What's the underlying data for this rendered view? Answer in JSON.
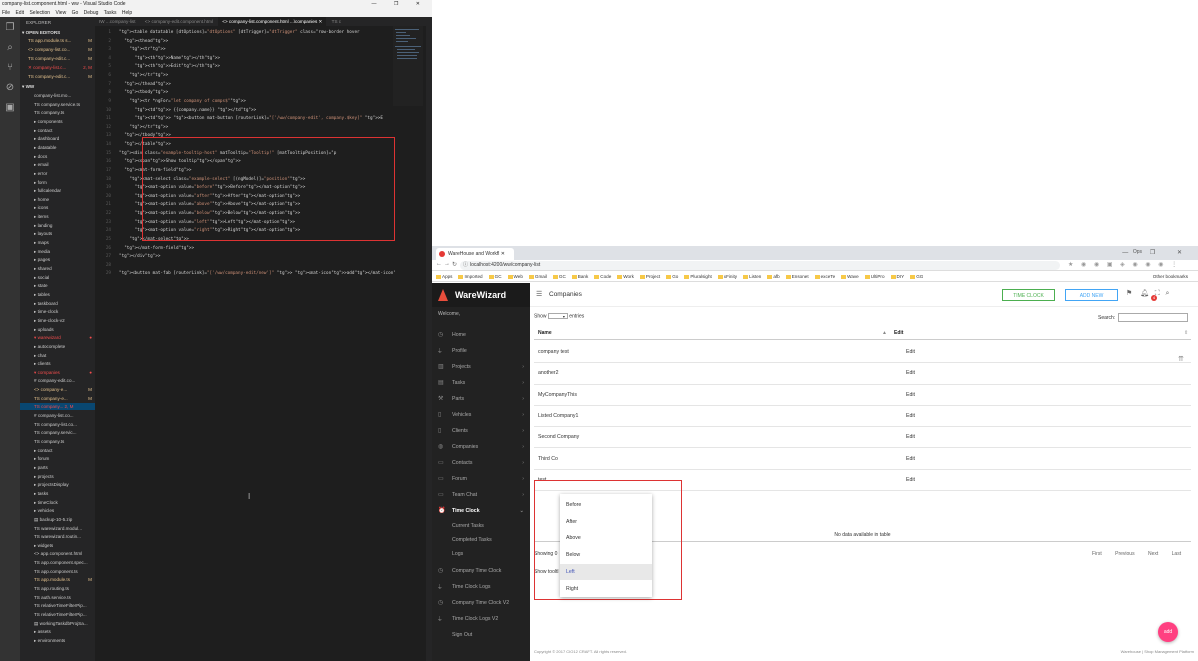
{
  "vscode": {
    "title": "company-list.component.html - ww - Visual Studio Code",
    "window_controls": "—  ❐  ✕",
    "menu": [
      "File",
      "Edit",
      "Selection",
      "View",
      "Go",
      "Debug",
      "Tasks",
      "Help"
    ],
    "explorer_label": "EXPLORER",
    "open_editors_label": "▾ OPEN EDITORS",
    "open_editors": [
      {
        "name": "TS app.module.ts  s...",
        "badge": "M",
        "cls": "m"
      },
      {
        "name": "<> company-list.co...",
        "badge": "M",
        "cls": "m"
      },
      {
        "name": "TS company-edit.c...",
        "badge": "M",
        "cls": "m"
      },
      {
        "name": "✕ company-list.c...",
        "badge": "2, M",
        "cls": "r"
      },
      {
        "name": "TS company-edit.c...",
        "badge": "M",
        "cls": "m"
      }
    ],
    "root_label": "▾ WW",
    "tree": [
      {
        "name": "company-list.mo...",
        "cls": ""
      },
      {
        "name": "TS company.service.ts",
        "cls": ""
      },
      {
        "name": "TS company.ts",
        "cls": ""
      },
      {
        "name": "▸ components",
        "cls": ""
      },
      {
        "name": "▸ contact",
        "cls": ""
      },
      {
        "name": "▸ dashboard",
        "cls": ""
      },
      {
        "name": "▸ datatable",
        "cls": ""
      },
      {
        "name": "▸ docs",
        "cls": ""
      },
      {
        "name": "▸ email",
        "cls": ""
      },
      {
        "name": "▸ error",
        "cls": ""
      },
      {
        "name": "▸ form",
        "cls": ""
      },
      {
        "name": "▸ fullcalendar",
        "cls": ""
      },
      {
        "name": "▸ home",
        "cls": ""
      },
      {
        "name": "▸ icons",
        "cls": ""
      },
      {
        "name": "▸ items",
        "cls": ""
      },
      {
        "name": "▸ landing",
        "cls": ""
      },
      {
        "name": "▸ layouts",
        "cls": ""
      },
      {
        "name": "▸ maps",
        "cls": ""
      },
      {
        "name": "▸ media",
        "cls": ""
      },
      {
        "name": "▸ pages",
        "cls": ""
      },
      {
        "name": "▸ shared",
        "cls": ""
      },
      {
        "name": "▸ social",
        "cls": ""
      },
      {
        "name": "▸ state",
        "cls": ""
      },
      {
        "name": "▸ tables",
        "cls": ""
      },
      {
        "name": "▸ taskboard",
        "cls": ""
      },
      {
        "name": "▸ time-clock",
        "cls": ""
      },
      {
        "name": "▸ time-clock-v2",
        "cls": ""
      },
      {
        "name": "▸ uploads",
        "cls": ""
      },
      {
        "name": "▾ warewizard",
        "cls": "r",
        "badge": "●"
      },
      {
        "name": "  ▸ autocomplete",
        "cls": ""
      },
      {
        "name": "  ▸ chat",
        "cls": ""
      },
      {
        "name": "  ▸ clients",
        "cls": ""
      },
      {
        "name": "  ▾ companies",
        "cls": "r",
        "badge": "●"
      },
      {
        "name": "    # company-edit.co...",
        "cls": ""
      },
      {
        "name": "    <> company-e...",
        "cls": "m",
        "badge": "M"
      },
      {
        "name": "    TS company-e...",
        "cls": "m",
        "badge": "M"
      },
      {
        "name": "    TS company... 2, M",
        "cls": "r",
        "sel": true
      },
      {
        "name": "    # company-list.co...",
        "cls": ""
      },
      {
        "name": "    TS company-list.co...",
        "cls": ""
      },
      {
        "name": "    TS company.servic...",
        "cls": ""
      },
      {
        "name": "    TS company.ts",
        "cls": ""
      },
      {
        "name": "  ▸ contact",
        "cls": ""
      },
      {
        "name": "  ▸ forum",
        "cls": ""
      },
      {
        "name": "  ▸ parts",
        "cls": ""
      },
      {
        "name": "  ▸ projects",
        "cls": ""
      },
      {
        "name": "  ▸ projectsDisplay",
        "cls": ""
      },
      {
        "name": "  ▸ tasks",
        "cls": ""
      },
      {
        "name": "  ▸ timeClock",
        "cls": ""
      },
      {
        "name": "  ▸ vehicles",
        "cls": ""
      },
      {
        "name": "  ▤ backup-10-5.zip",
        "cls": ""
      },
      {
        "name": "  TS warewizard.modul...",
        "cls": ""
      },
      {
        "name": "  TS warewizard.routin...",
        "cls": ""
      },
      {
        "name": "▸ widgets",
        "cls": ""
      },
      {
        "name": "<> app.component.html",
        "cls": ""
      },
      {
        "name": "TS app.component.spec...",
        "cls": ""
      },
      {
        "name": "TS app.component.ts",
        "cls": ""
      },
      {
        "name": "TS app.module.ts",
        "cls": "m",
        "badge": "M"
      },
      {
        "name": "TS app.routing.ts",
        "cls": ""
      },
      {
        "name": "TS auth.service.ts",
        "cls": ""
      },
      {
        "name": "TS relativeTimeFilterPip...",
        "cls": ""
      },
      {
        "name": "TS relativeTimeFilterPip...",
        "cls": ""
      },
      {
        "name": "▤ workingTaskdbProjSa...",
        "cls": ""
      },
      {
        "name": "▸ assets",
        "cls": ""
      },
      {
        "name": "▸ environments",
        "cls": ""
      }
    ],
    "tabs": [
      {
        "label": "IW  ...company-list",
        "active": false
      },
      {
        "label": "<> company-edit.component.html",
        "active": false
      },
      {
        "label": "<> company-list.component.html  ...\\companies ✕",
        "active": true
      },
      {
        "label": "TS c",
        "active": false
      }
    ],
    "code": [
      {
        "n": "1",
        "t": "<table datatable [dtOptions]=\"dtOptions\" [dtTrigger]=\"dtTrigger\" class=\"row-border hover"
      },
      {
        "n": "2",
        "t": "  <thead>"
      },
      {
        "n": "3",
        "t": "    <tr>"
      },
      {
        "n": "4",
        "t": "      <th>Name</th>"
      },
      {
        "n": "5",
        "t": "      <th>Edit</th>"
      },
      {
        "n": "6",
        "t": "    </tr>"
      },
      {
        "n": "7",
        "t": "  </thead>"
      },
      {
        "n": "8",
        "t": "  <tbody>"
      },
      {
        "n": "9",
        "t": "    <tr *ngFor=\"let company of comps$\">"
      },
      {
        "n": "10",
        "t": "      <td> {{company.name}} </td>"
      },
      {
        "n": "11",
        "t": "      <td> <button mat-button [routerLink]=\"['/ww/company-edit', company.$key]\" >E"
      },
      {
        "n": "12",
        "t": "    </tr>"
      },
      {
        "n": "13",
        "t": "  </tbody>"
      },
      {
        "n": "14",
        "t": "  </table>"
      },
      {
        "n": "15",
        "t": "<div class=\"example-tooltip-host\" matTooltip=\"Tooltip!\" [matTooltipPosition]=\"p"
      },
      {
        "n": "16",
        "t": "  <span>Show tooltip</span>"
      },
      {
        "n": "17",
        "t": "  <mat-form-field>"
      },
      {
        "n": "18",
        "t": "    <mat-select class=\"example-select\" [(ngModel)]=\"position\">"
      },
      {
        "n": "19",
        "t": "      <mat-option value=\"before\">Before</mat-option>"
      },
      {
        "n": "20",
        "t": "      <mat-option value=\"after\">After</mat-option>"
      },
      {
        "n": "21",
        "t": "      <mat-option value=\"above\">Above</mat-option>"
      },
      {
        "n": "22",
        "t": "      <mat-option value=\"below\">Below</mat-option>"
      },
      {
        "n": "23",
        "t": "      <mat-option value=\"left\">Left</mat-option>"
      },
      {
        "n": "24",
        "t": "      <mat-option value=\"right\">Right</mat-option>"
      },
      {
        "n": "25",
        "t": "    </mat-select>"
      },
      {
        "n": "26",
        "t": "  </mat-form-field>"
      },
      {
        "n": "27",
        "t": "</div>"
      },
      {
        "n": "28",
        "t": ""
      },
      {
        "n": "29",
        "t": "<button mat-fab [routerLink]=\"['/ww/company-edit/new']\" > <mat-icon>add</mat-icon> </but"
      }
    ]
  },
  "browser": {
    "tab_title": "WareHouse and Workfl ✕",
    "profile": "Ops",
    "window_controls": "—  ❐  ✕",
    "url": "localhost:4200/ww/company-list",
    "bookmarks": [
      "Apps",
      "Imported",
      "GC",
      "Web",
      "Gmail",
      "GC",
      "Bank",
      "Code",
      "Work",
      "Project",
      "Go",
      "Pluralsight",
      "xFinity",
      "Listen",
      "afb",
      "Ensonet",
      "exceTe",
      "Wave",
      "UltiPro",
      "DIY",
      "GG"
    ],
    "other_bookmarks": "Other bookmarks"
  },
  "app": {
    "brand": "WareWizard",
    "welcome": "Welcome,",
    "nav": [
      {
        "icon": "◷",
        "label": "Home",
        "chev": ""
      },
      {
        "icon": "⍊",
        "label": "Profile",
        "chev": ""
      },
      {
        "icon": "▥",
        "label": "Projects",
        "chev": "›"
      },
      {
        "icon": "▤",
        "label": "Tasks",
        "chev": "›"
      },
      {
        "icon": "⚒",
        "label": "Parts",
        "chev": "›"
      },
      {
        "icon": "▯",
        "label": "Vehicles",
        "chev": "›"
      },
      {
        "icon": "▯",
        "label": "Clients",
        "chev": "›"
      },
      {
        "icon": "◍",
        "label": "Companies",
        "chev": "›"
      },
      {
        "icon": "▭",
        "label": "Contacts",
        "chev": "›"
      },
      {
        "icon": "▭",
        "label": "Forum",
        "chev": "›"
      },
      {
        "icon": "▭",
        "label": "Team Chat",
        "chev": "›"
      },
      {
        "icon": "⏰",
        "label": "Time Clock",
        "chev": "⌄",
        "active": true
      }
    ],
    "subnav": [
      "Current Tasks",
      "Completed Tasks",
      "Logs"
    ],
    "nav2": [
      {
        "icon": "◷",
        "label": "Company Time Clock"
      },
      {
        "icon": "⍊",
        "label": "Time Clock Logs"
      },
      {
        "icon": "◷",
        "label": "Company Time Clock V2"
      },
      {
        "icon": "⍊",
        "label": "Time Clock Logs V2"
      },
      {
        "icon": "",
        "label": "Sign Out"
      }
    ],
    "page_title": "Companies",
    "btn_time_clock": "TIME CLOCK",
    "btn_add_new": "ADD NEW",
    "notif_count": "4",
    "show_label": "Show",
    "entries_label": "entries",
    "search_label": "Search:",
    "columns": [
      "Name",
      "Edit"
    ],
    "rows": [
      {
        "name": "company test",
        "edit": "Edit"
      },
      {
        "name": "another2",
        "edit": "Edit"
      },
      {
        "name": "MyCompanyThis",
        "edit": "Edit"
      },
      {
        "name": "Listed Company1",
        "edit": "Edit"
      },
      {
        "name": "Second Company",
        "edit": "Edit"
      },
      {
        "name": "Third Co",
        "edit": "Edit"
      },
      {
        "name": "test",
        "edit": "Edit"
      }
    ],
    "no_data": "No data available in table",
    "showing": "Showing 0",
    "pager": [
      "First",
      "Previous",
      "Next",
      "Last"
    ],
    "show_tooltip": "Show tooltl",
    "options": [
      "Before",
      "After",
      "Above",
      "Below",
      "Left",
      "Right"
    ],
    "selected_option": "Left",
    "footer_left": "Copyright © 2017 CIO12 CRAFT. All rights reserved.",
    "footer_right": "Warehouse | Shop Management Platform",
    "fab": "add"
  }
}
